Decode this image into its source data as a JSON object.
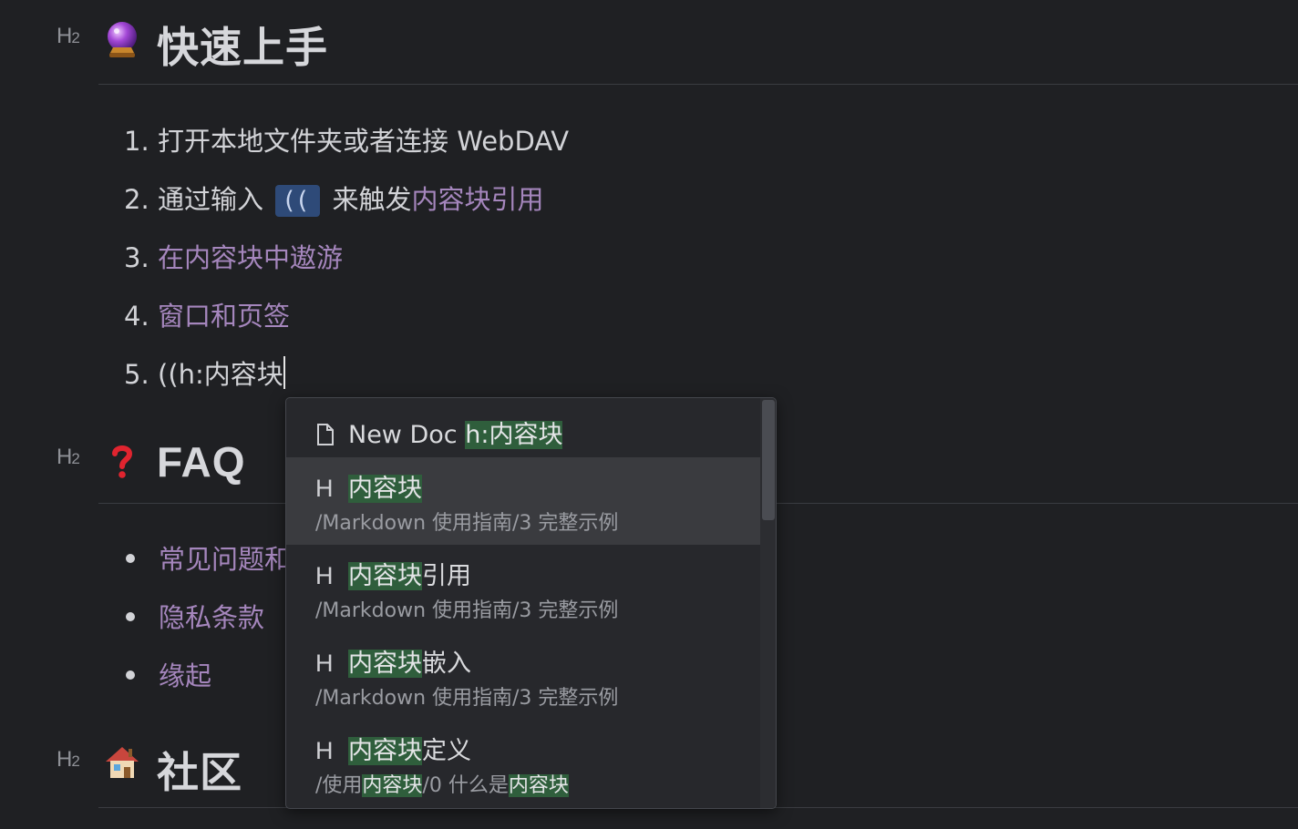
{
  "sections": {
    "quickstart": {
      "marker": "H",
      "marker_sub": "2",
      "title": "快速上手",
      "icon": "crystal-ball-emoji"
    },
    "faq": {
      "marker": "H",
      "marker_sub": "2",
      "title": "FAQ",
      "icon": "red-question-mark-emoji"
    },
    "community": {
      "marker": "H",
      "marker_sub": "2",
      "title": "社区",
      "icon": "house-emoji"
    }
  },
  "steps": [
    {
      "num": "1.",
      "text": "打开本地文件夹或者连接 WebDAV"
    },
    {
      "num": "2.",
      "text_before": "通过输入",
      "code": "((",
      "text_mid": "来触发",
      "link": "内容块引用"
    },
    {
      "num": "3.",
      "link": "在内容块中遨游"
    },
    {
      "num": "4.",
      "link": "窗口和页签"
    },
    {
      "num": "5.",
      "text": "((h:内容块"
    }
  ],
  "faq_items": [
    {
      "text": "常见问题和"
    },
    {
      "text": "隐私条款"
    },
    {
      "text": "缘起"
    }
  ],
  "popup": {
    "new_doc": {
      "icon": "file-icon",
      "label": "New Doc",
      "query": "h:内容块"
    },
    "results": [
      {
        "type": "H",
        "match": "内容块",
        "rest": "",
        "path": "/Markdown 使用指南/3 完整示例"
      },
      {
        "type": "H",
        "match": "内容块",
        "rest": "引用",
        "path": "/Markdown 使用指南/3 完整示例"
      },
      {
        "type": "H",
        "match": "内容块",
        "rest": "嵌入",
        "path": "/Markdown 使用指南/3 完整示例"
      },
      {
        "type": "H",
        "match": "内容块",
        "rest": "定义",
        "path_parts": [
          "/使用",
          "内容块",
          "/0 什么是",
          "内容块"
        ]
      }
    ]
  }
}
